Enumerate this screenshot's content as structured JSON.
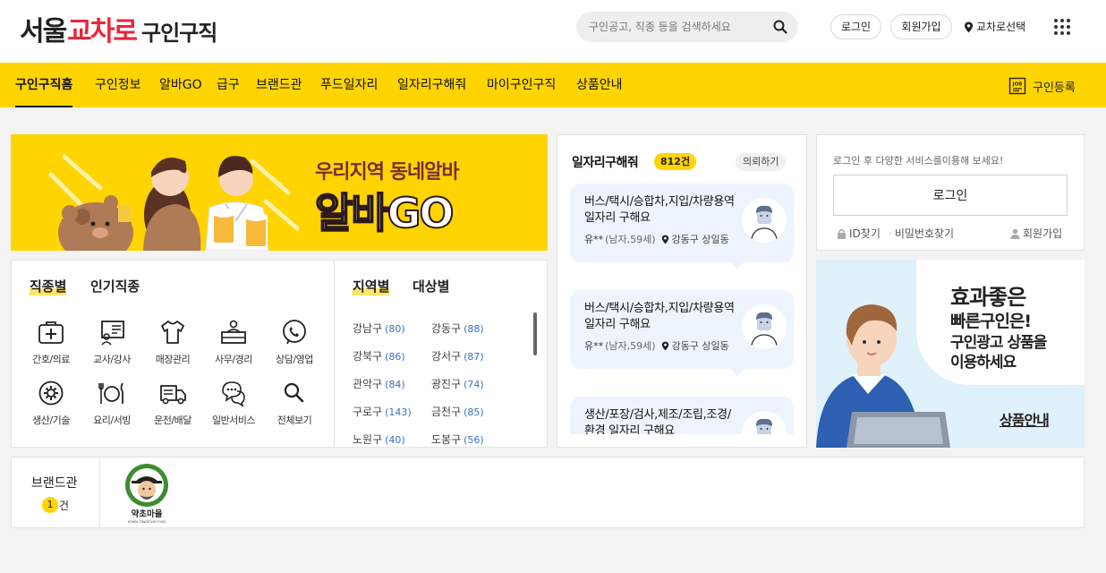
{
  "header": {
    "logo": {
      "part1": "서울",
      "part2": "교차로",
      "part3": "구인구직"
    },
    "search": {
      "placeholder": "구인공고, 직종 등을 검색하세요"
    },
    "login_label": "로그인",
    "join_label": "회원가입",
    "region_label": "교차로선택"
  },
  "nav": {
    "items": [
      "구인구직홈",
      "구인정보",
      "알바GO",
      "급구",
      "브랜드관",
      "푸드일자리",
      "일자리구해줘",
      "마이구인구직",
      "상품안내"
    ],
    "register_label": "구인등록",
    "job_icon_text": "JOB"
  },
  "banner": {
    "title1": "우리지역 동네알바",
    "title2": "알바GO"
  },
  "categories": {
    "tabs": [
      "직종별",
      "인기직종"
    ],
    "items": [
      {
        "label": "간호/의료",
        "icon": "medical-kit-icon"
      },
      {
        "label": "교사/강사",
        "icon": "teacher-board-icon"
      },
      {
        "label": "매장관리",
        "icon": "shirt-icon"
      },
      {
        "label": "사무/경리",
        "icon": "office-desk-icon"
      },
      {
        "label": "상담/영업",
        "icon": "phone-call-icon"
      },
      {
        "label": "생산/기술",
        "icon": "gear-icon"
      },
      {
        "label": "요리/서빙",
        "icon": "dining-icon"
      },
      {
        "label": "운전/배달",
        "icon": "truck-icon"
      },
      {
        "label": "일반서비스",
        "icon": "chat-bubbles-icon"
      },
      {
        "label": "전체보기",
        "icon": "search-icon"
      }
    ]
  },
  "regions": {
    "tabs": [
      "지역별",
      "대상별"
    ],
    "items": [
      {
        "name": "강남구",
        "count": "(80)"
      },
      {
        "name": "강동구",
        "count": "(88)"
      },
      {
        "name": "강북구",
        "count": "(86)"
      },
      {
        "name": "강서구",
        "count": "(87)"
      },
      {
        "name": "관악구",
        "count": "(84)"
      },
      {
        "name": "광진구",
        "count": "(74)"
      },
      {
        "name": "구로구",
        "count": "(143)"
      },
      {
        "name": "금천구",
        "count": "(85)"
      },
      {
        "name": "노원구",
        "count": "(40)"
      },
      {
        "name": "도봉구",
        "count": "(56)"
      }
    ]
  },
  "job_requests": {
    "title": "일자리구해줘",
    "count": "812건",
    "more_label": "의뢰하기",
    "cards": [
      {
        "text": "버스/택시/승합차,지입/차량용역 일자리 구해요",
        "name": "유**",
        "age": "(남자,59세)",
        "location": "강동구 상일동"
      },
      {
        "text": "버스/택시/승합차,지입/차량용역 일자리 구해요",
        "name": "유**",
        "age": "(남자,59세)",
        "location": "강동구 상일동"
      },
      {
        "text": "생산/포장/검사,제조/조립,조경/환경 일자리 구해요",
        "name": "",
        "age": "",
        "location": ""
      }
    ]
  },
  "login_box": {
    "message": "로그인 후 다양한 서비스를이용해 보세요!",
    "button_label": "로그인",
    "find_id": "ID찾기",
    "find_pw": "비밀번호찾기",
    "join": "회원가입"
  },
  "ad": {
    "line1": "효과좋은",
    "line2": "빠른구인은!",
    "line3": "구인광고 상품을",
    "line4": "이용하세요",
    "link_label": "상품안내"
  },
  "brand": {
    "title": "브랜드관",
    "count": "1",
    "count_suffix": "건",
    "logo_text": "약초마을",
    "logo_subtext": "KOREA TRADITION FOOD"
  },
  "colors": {
    "accent": "#ffd400",
    "brand_red": "#e5293a",
    "link_blue": "#3c6fc9",
    "card_bg": "#eef4fe"
  }
}
